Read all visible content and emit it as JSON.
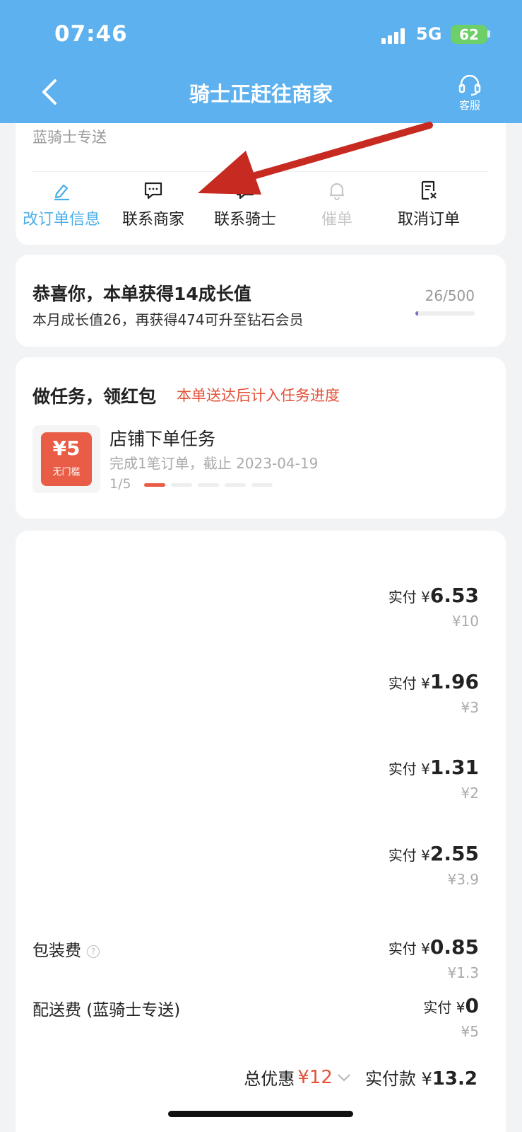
{
  "status_bar": {
    "time": "07:46",
    "network": "5G",
    "battery": "62"
  },
  "header": {
    "title": "骑士正赶往商家",
    "customer_service": "客服"
  },
  "delivery": {
    "rider_label": "蓝骑士专送"
  },
  "actions": [
    {
      "label": "改订单信息",
      "icon": "edit-icon",
      "state": "active"
    },
    {
      "label": "联系商家",
      "icon": "chat-icon",
      "state": "normal"
    },
    {
      "label": "联系骑士",
      "icon": "chat-icon",
      "state": "normal"
    },
    {
      "label": "催单",
      "icon": "bell-icon",
      "state": "disabled"
    },
    {
      "label": "取消订单",
      "icon": "cancel-order-icon",
      "state": "normal"
    }
  ],
  "growth": {
    "title": "恭喜你，本单获得14成长值",
    "subtitle": "本月成长值26，再获得474可升至钻石会员",
    "count": "26/500",
    "progress": 0.052
  },
  "task": {
    "heading": "做任务，领红包",
    "note": "本单送达后计入任务进度",
    "coupon_value": "¥5",
    "coupon_label": "无门槛",
    "name": "店铺下单任务",
    "description": "完成1笔订单，截止 2023-04-19",
    "progress_text": "1/5",
    "progress_done": 1,
    "progress_total": 5
  },
  "items": [
    {
      "pay_label": "实付 ¥",
      "pay": "6.53",
      "original": "¥10"
    },
    {
      "pay_label": "实付 ¥",
      "pay": "1.96",
      "original": "¥3"
    },
    {
      "pay_label": "实付 ¥",
      "pay": "1.31",
      "original": "¥2"
    },
    {
      "pay_label": "实付 ¥",
      "pay": "2.55",
      "original": "¥3.9"
    }
  ],
  "packaging": {
    "label": "包装费",
    "pay_label": "实付 ¥",
    "pay": "0.85",
    "original": "¥1.3"
  },
  "delivery_fee": {
    "label": "配送费 (蓝骑士专送)",
    "pay_label": "实付 ¥",
    "pay": "0",
    "original": "¥5"
  },
  "totals": {
    "discount_label": "总优惠",
    "discount": "¥12",
    "paid_label": "实付款 ¥",
    "paid": "13.2"
  }
}
